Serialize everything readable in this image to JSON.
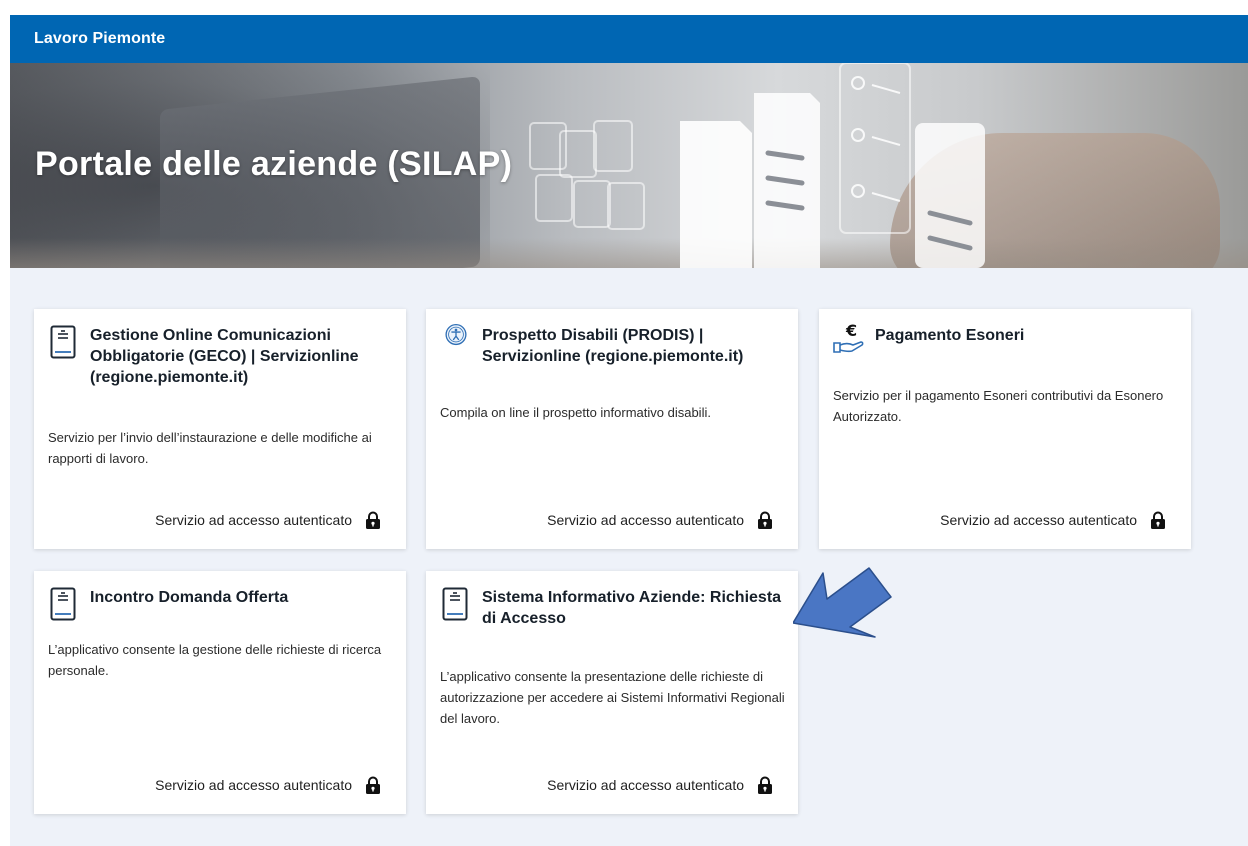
{
  "header": {
    "brand": "Lavoro Piemonte"
  },
  "hero": {
    "title": "Portale delle aziende (SILAP)"
  },
  "cards": [
    {
      "title": "Gestione Online Comunicazioni Obbligatorie (GECO) | Servizionline (regione.piemonte.it)",
      "description": "Servizio per l’invio dell’instaurazione e delle modifiche ai rapporti di lavoro.",
      "footer": "Servizio ad accesso autenticato",
      "icon": "document-icon"
    },
    {
      "title": "Prospetto Disabili (PRODIS) | Servizionline (regione.piemonte.it)",
      "description": "Compila on line il prospetto informativo disabili.",
      "footer": "Servizio ad accesso autenticato",
      "icon": "accessibility-icon"
    },
    {
      "title": "Pagamento Esoneri",
      "description": "Servizio per il pagamento Esoneri contributivi da Esonero Autorizzato.",
      "footer": "Servizio ad accesso autenticato",
      "icon": "euro-hand-icon"
    },
    {
      "title": "Incontro Domanda Offerta",
      "description": "L’applicativo consente la gestione delle richieste di ricerca personale.",
      "footer": "Servizio ad accesso autenticato",
      "icon": "document-icon"
    },
    {
      "title": "Sistema Informativo Aziende: Richiesta di Accesso",
      "description": "L’applicativo consente la presentazione delle richieste di autorizzazione per accedere ai Sistemi Informativi Regionali del lavoro.",
      "footer": "Servizio ad accesso autenticato",
      "icon": "document-icon"
    }
  ],
  "colors": {
    "topbar": "#0066b3",
    "page_background": "#eef2f9",
    "card_background": "#ffffff",
    "annotation_arrow": "#4a76c4",
    "icon_accent": "#2f6fb5"
  }
}
